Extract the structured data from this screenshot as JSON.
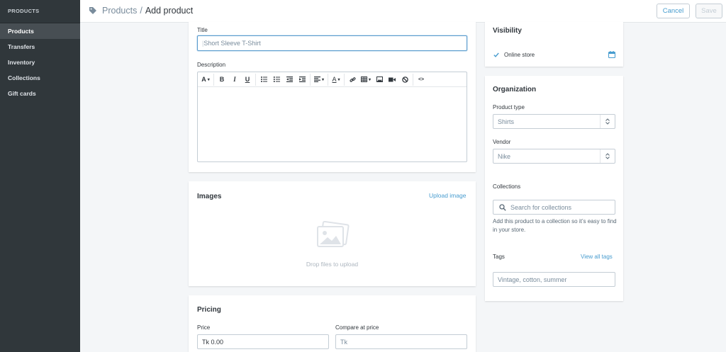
{
  "sidebar": {
    "header": "PRODUCTS",
    "items": [
      {
        "label": "Products"
      },
      {
        "label": "Transfers"
      },
      {
        "label": "Inventory"
      },
      {
        "label": "Collections"
      },
      {
        "label": "Gift cards"
      }
    ]
  },
  "header": {
    "breadcrumb_parent": "Products",
    "breadcrumb_sep": "/",
    "title": "Add product",
    "cancel_label": "Cancel",
    "save_label": "Save"
  },
  "details": {
    "title_label": "Title",
    "title_placeholder": "Short Sleeve T-Shirt",
    "description_label": "Description",
    "toolbar_font": "A",
    "toolbar_bold": "B",
    "toolbar_italic": "I",
    "toolbar_underline": "U",
    "toolbar_color": "A",
    "toolbar_html": "<>"
  },
  "images": {
    "title": "Images",
    "upload_link": "Upload image",
    "drop_text": "Drop files to upload"
  },
  "pricing": {
    "title": "Pricing",
    "price_label": "Price",
    "price_value": "Tk 0.00",
    "compare_label": "Compare at price",
    "compare_placeholder": "Tk"
  },
  "visibility": {
    "title": "Visibility",
    "online_store": "Online store"
  },
  "organization": {
    "title": "Organization",
    "product_type_label": "Product type",
    "product_type_placeholder": "Shirts",
    "vendor_label": "Vendor",
    "vendor_placeholder": "Nike",
    "collections_label": "Collections",
    "collections_placeholder": "Search for collections",
    "collections_help": "Add this product to a collection so it’s easy to find in your store.",
    "tags_label": "Tags",
    "tags_link": "View all tags",
    "tags_placeholder": "Vintage, cotton, summer"
  },
  "colors": {
    "sidebar_bg": "#30373b",
    "accent": "#479ccf",
    "page_bg": "#f4f6f8"
  }
}
